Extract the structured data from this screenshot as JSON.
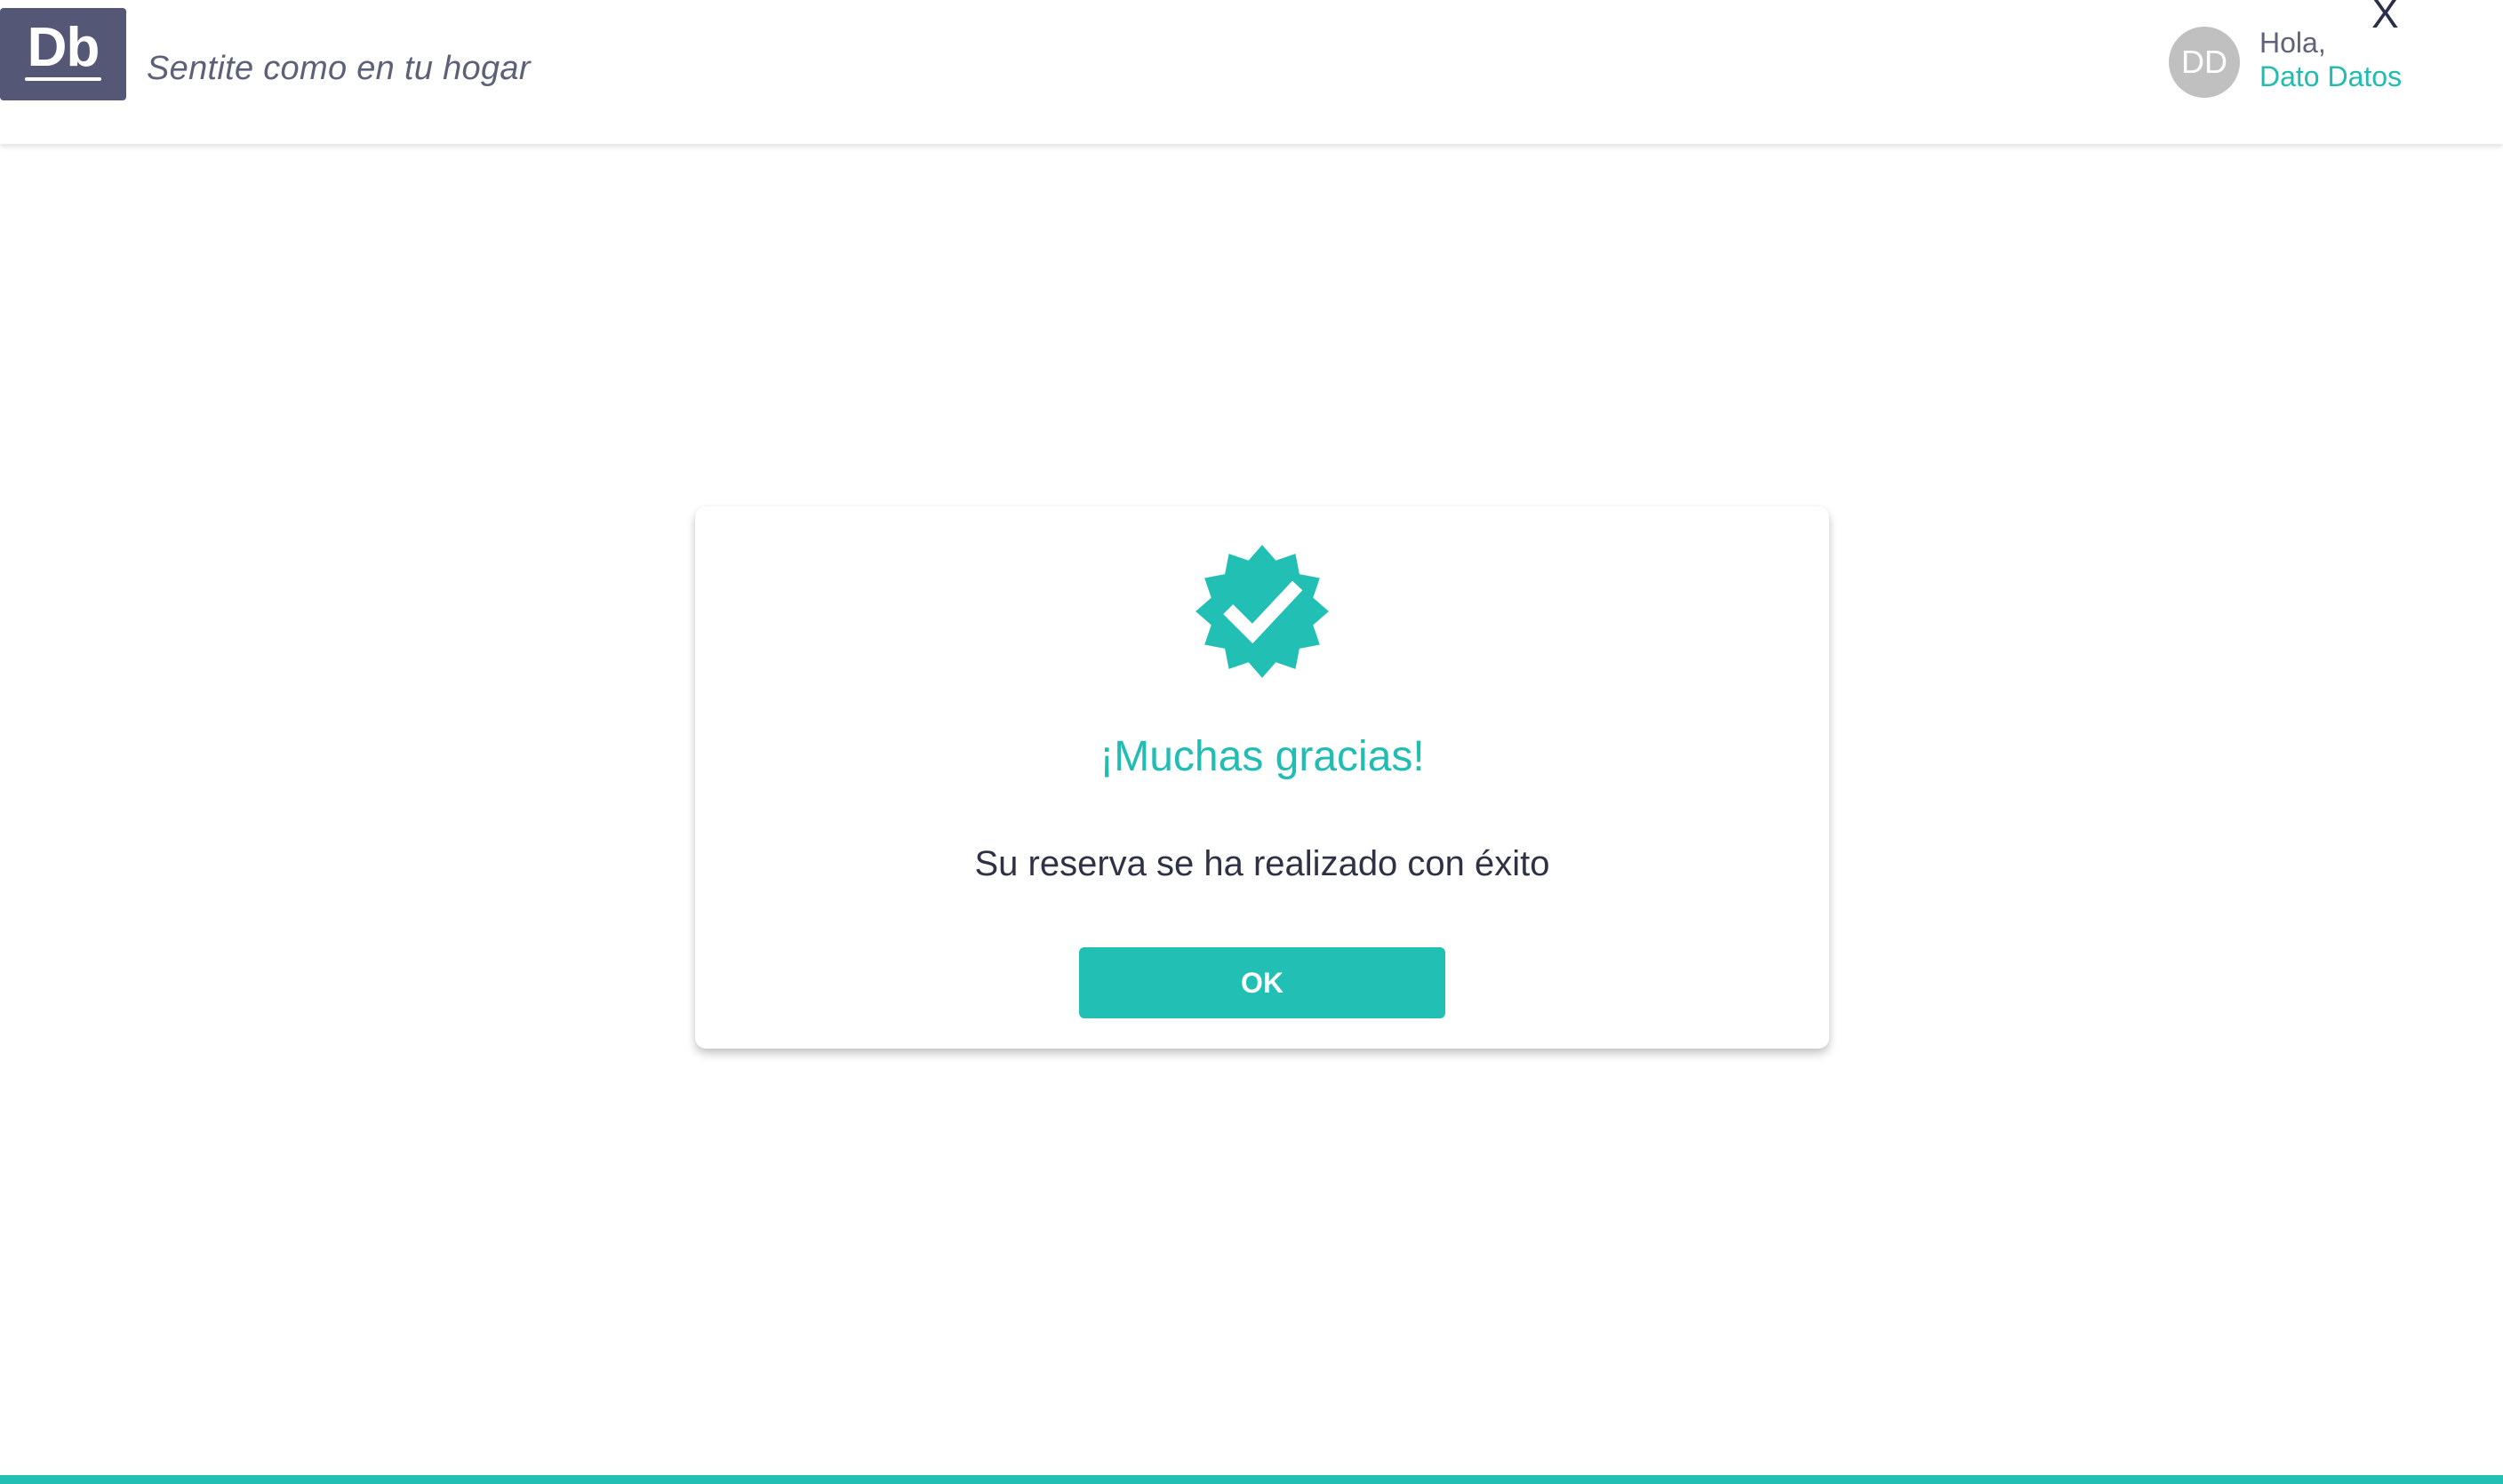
{
  "header": {
    "logo_text": "Db",
    "slogan": "Sentite como en tu hogar",
    "avatar_initials": "DD",
    "greeting": "Hola,",
    "username": "Dato Datos",
    "close_label": "X"
  },
  "modal": {
    "icon": "verified-badge-check-icon",
    "title": "¡Muchas gracias!",
    "message": "Su reserva se ha realizado con éxito",
    "ok_label": "OK"
  },
  "colors": {
    "accent": "#22bfb4",
    "brand": "#545775",
    "text_dark": "#2f3245",
    "avatar_bg": "#c0c0c0"
  }
}
